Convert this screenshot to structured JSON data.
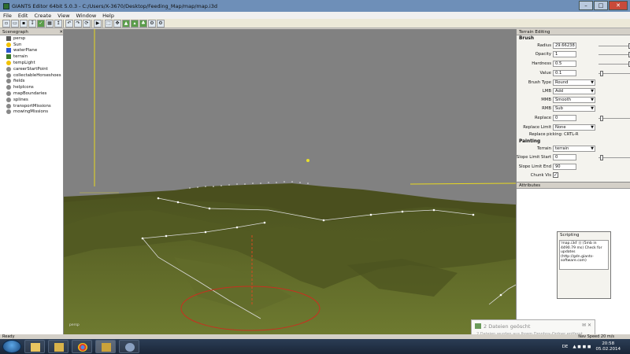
{
  "window": {
    "title": "GIANTS Editor 64bit 5.0.3 - C:/Users/X-3670/Desktop/Feeding_Map/map/map.i3d",
    "minimize": "–",
    "maximize": "□",
    "close": "✕"
  },
  "menu": [
    "File",
    "Edit",
    "Create",
    "View",
    "Window",
    "Help"
  ],
  "scenegraph": {
    "title": "Scenegraph",
    "items": [
      {
        "label": "persp",
        "icon": "camera-icon",
        "color": "#5a5a5a"
      },
      {
        "label": "Sun",
        "icon": "sun-icon",
        "color": "#f2c200"
      },
      {
        "label": "waterPlane",
        "icon": "water-icon",
        "color": "#2a55d0"
      },
      {
        "label": "terrain",
        "icon": "terrain-icon",
        "color": "#3a7a2a"
      },
      {
        "label": "tempLight",
        "icon": "light-icon",
        "color": "#f2c200"
      },
      {
        "label": "careerStartPoint",
        "icon": "transform-icon",
        "color": "#888888"
      },
      {
        "label": "collectableHorseshoes",
        "icon": "transform-icon",
        "color": "#888888"
      },
      {
        "label": "fields",
        "icon": "transform-icon",
        "color": "#888888"
      },
      {
        "label": "helpIcons",
        "icon": "transform-icon",
        "color": "#888888"
      },
      {
        "label": "mapBoundaries",
        "icon": "transform-icon",
        "color": "#888888"
      },
      {
        "label": "splines",
        "icon": "transform-icon",
        "color": "#888888"
      },
      {
        "label": "transportMissions",
        "icon": "transform-icon",
        "color": "#888888"
      },
      {
        "label": "mowingMissions",
        "icon": "transform-icon",
        "color": "#888888"
      }
    ]
  },
  "viewport": {
    "camera_label": "persp"
  },
  "terrain_editing": {
    "title": "Terrain Editing",
    "brush_section": "Brush",
    "radius_label": "Radius",
    "radius_value": "29.66238",
    "opacity_label": "Opacity",
    "opacity_value": "1",
    "hardness_label": "Hardness",
    "hardness_value": "0.5",
    "value_label": "Value",
    "value_value": "0.1",
    "brush_type_label": "Brush Type",
    "brush_type_value": "Round",
    "lmb_label": "LMB",
    "lmb_value": "Add",
    "mmb_label": "MMB",
    "mmb_value": "Smooth",
    "rmb_label": "RMB",
    "rmb_value": "Sub",
    "replace_label": "Replace",
    "replace_value": "0",
    "replace_limit_label": "Replace Limit",
    "replace_limit_value": "None",
    "replace_picking_hint": "Replace picking: CRTL-R",
    "painting_section": "Painting",
    "terrain_label": "Terrain",
    "terrain_value": "terrain",
    "slope_start_label": "Slope Limit Start",
    "slope_start_value": "0",
    "slope_end_label": "Slope Limit End",
    "slope_end_value": "90",
    "chunk_label": "Chunk Vis",
    "chunk_checked": "✓"
  },
  "attributes": {
    "title": "Attributes"
  },
  "scripting": {
    "title": "Scripting",
    "log": "'map.i3d' () (5mb in 4490.79 ms) Check for updates (http://gdn.giants-software.com)"
  },
  "notification": {
    "title": "2 Dateien geöscht",
    "detail": "2 Dateien wurden aus Ihrem Dropbox-Ordner entfernt",
    "buttons": "✉ ✕"
  },
  "statusbar": {
    "left": "Ready",
    "right": "Nav Speed 20 m/s"
  },
  "taskbar": {
    "lang": "DE",
    "time": "20:58",
    "date": "05.02.2014"
  }
}
